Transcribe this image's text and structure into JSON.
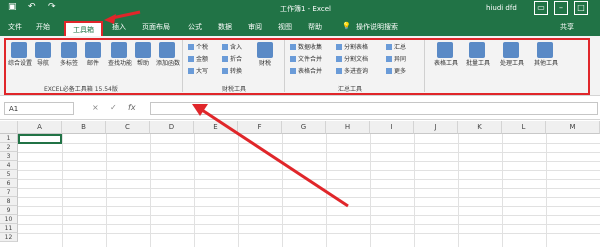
{
  "window": {
    "doc_title": "工作簿1 - Excel",
    "user": "hiudi dfd",
    "share": "共享",
    "tell_me": "操作说明搜索",
    "qa_icons": [
      "save-icon",
      "undo-icon",
      "redo-icon"
    ]
  },
  "tabs": [
    "文件",
    "开始",
    "工具箱",
    "插入",
    "页面布局",
    "公式",
    "数据",
    "审阅",
    "视图",
    "帮助"
  ],
  "active_tab": "工具箱",
  "ribbon": {
    "group1": {
      "label": "EXCEL必备工具箱 15.54版",
      "buttons": [
        "综合设置",
        "导航",
        "多标签",
        "邮件",
        "查找功能",
        "帮助",
        "添加函数"
      ]
    },
    "group2": {
      "label": "财税工具",
      "small": [
        "个税",
        "金额",
        "大写",
        "含入",
        "折合",
        "转换",
        "财税"
      ]
    },
    "group3": {
      "label": "汇总工具",
      "small": [
        "数据收集",
        "文件合并",
        "表格合并",
        "分割表格",
        "分割文档",
        "多进查询",
        "汇总",
        "异同",
        "更多"
      ]
    },
    "group4": {
      "buttons": [
        "表格工具",
        "批量工具",
        "处理工具",
        "其他工具"
      ]
    }
  },
  "formula": {
    "name_box": "A1",
    "fx_label": "fx",
    "cancel": "×",
    "enter": "✓"
  },
  "grid": {
    "columns": [
      "A",
      "B",
      "C",
      "D",
      "E",
      "F",
      "G",
      "H",
      "I",
      "J",
      "K",
      "L",
      "M"
    ],
    "rows": [
      "1",
      "2",
      "3",
      "4",
      "5",
      "6",
      "7",
      "8",
      "9",
      "10",
      "11",
      "12"
    ]
  },
  "colors": {
    "accent": "#217346",
    "highlight": "#e0262a"
  }
}
